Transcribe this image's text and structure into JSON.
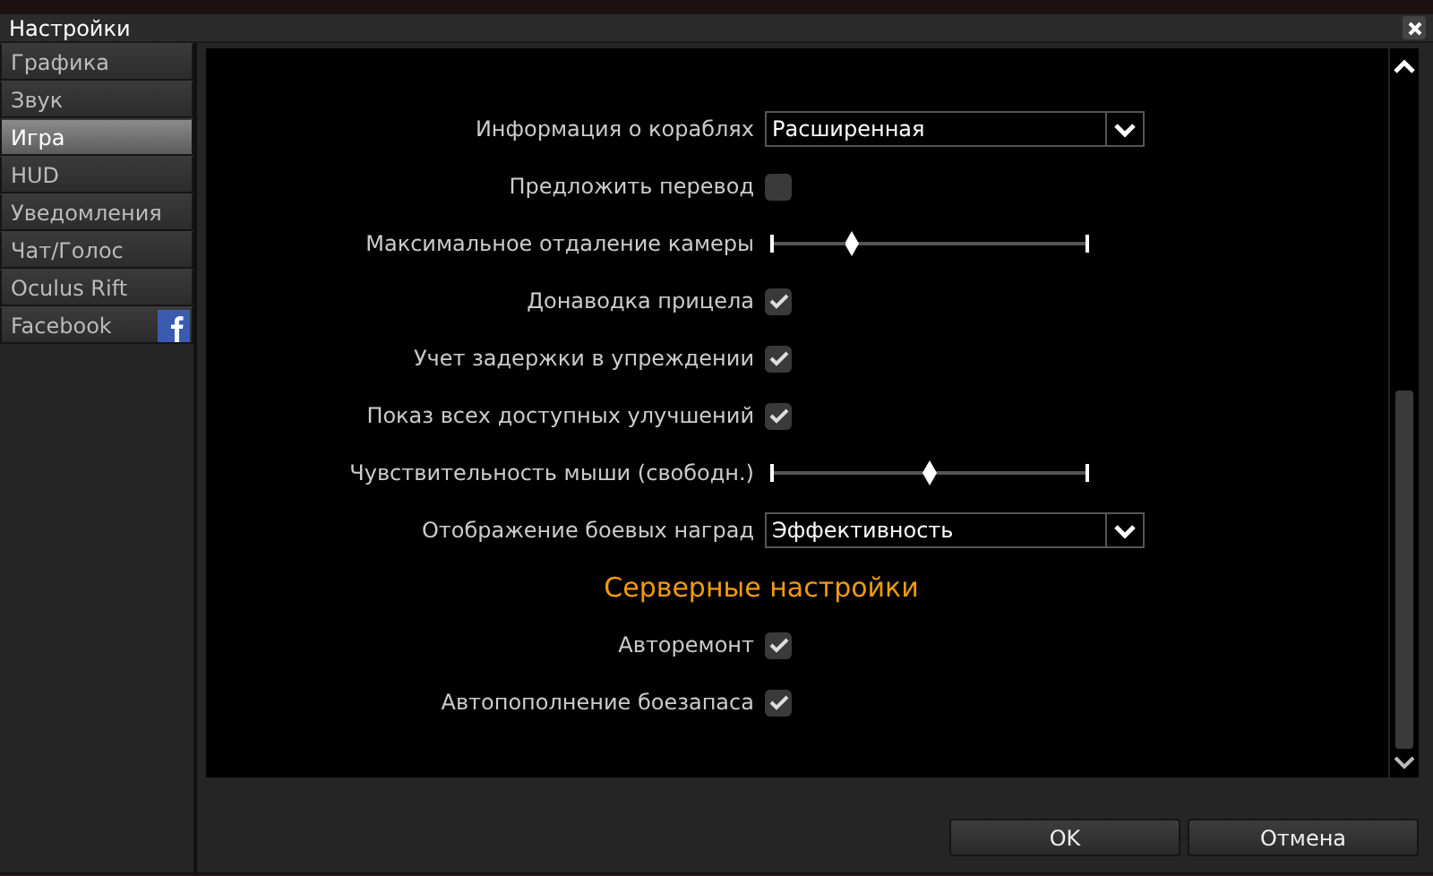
{
  "window": {
    "title": "Настройки"
  },
  "sidebar": {
    "items": [
      {
        "label": "Графика",
        "selected": false
      },
      {
        "label": "Звук",
        "selected": false
      },
      {
        "label": "Игра",
        "selected": true
      },
      {
        "label": "HUD",
        "selected": false
      },
      {
        "label": "Уведомления",
        "selected": false
      },
      {
        "label": "Чат/Голос",
        "selected": false
      },
      {
        "label": "Oculus Rift",
        "selected": false
      },
      {
        "label": "Facebook",
        "selected": false,
        "kind": "facebook"
      }
    ]
  },
  "settings": [
    {
      "kind": "dropdown",
      "label": "Информация о кораблях",
      "value": "Расширенная"
    },
    {
      "kind": "checkbox",
      "label": "Предложить перевод",
      "checked": false
    },
    {
      "kind": "slider",
      "label": "Максимальное отдаление камеры",
      "level": 0.25
    },
    {
      "kind": "checkbox",
      "label": "Донаводка прицела",
      "checked": true
    },
    {
      "kind": "checkbox",
      "label": "Учет задержки в упреждении",
      "checked": true
    },
    {
      "kind": "checkbox",
      "label": "Показ всех доступных улучшений",
      "checked": true
    },
    {
      "kind": "slider",
      "label": "Чувствительность мыши (свободн.)",
      "level": 0.5
    },
    {
      "kind": "dropdown",
      "label": "Отображение боевых наград",
      "value": "Эффективность"
    },
    {
      "kind": "heading",
      "label": "Серверные настройки"
    },
    {
      "kind": "checkbox",
      "label": "Авторемонт",
      "checked": true
    },
    {
      "kind": "checkbox",
      "label": "Автопополнение боезапаса",
      "checked": true
    }
  ],
  "buttons": [
    "OK",
    "Отмена"
  ]
}
